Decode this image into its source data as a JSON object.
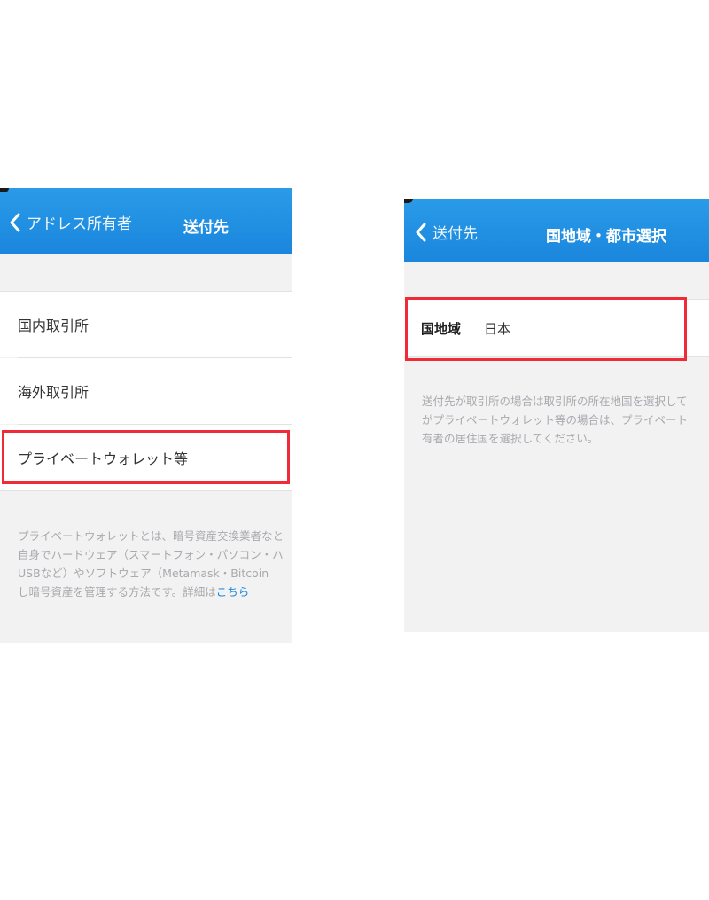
{
  "left": {
    "nav": {
      "back_label": "アドレス所有者",
      "title": "送付先"
    },
    "options": [
      {
        "label": "国内取引所"
      },
      {
        "label": "海外取引所"
      },
      {
        "label": "プライベートウォレット等"
      }
    ],
    "note": {
      "line1": "プライベートウォレットとは、暗号資産交換業者なと",
      "line2": "自身でハードウェア（スマートフォン・パソコン・ハ",
      "line3": "USBなど）やソフトウェア（Metamask・Bitcoin",
      "line4_text": "し暗号資産を管理する方法です。詳細は",
      "line4_link": "こちら"
    }
  },
  "right": {
    "nav": {
      "back_label": "送付先",
      "title": "国地域・都市選択"
    },
    "country": {
      "label": "国地域",
      "value": "日本"
    },
    "note": {
      "line1": "送付先が取引所の場合は取引所の所在地国を選択して",
      "line2": "がプライベートウォレット等の場合は、プライベート",
      "line3": "有者の居住国を選択してください。"
    }
  },
  "colors": {
    "nav_blue": "#1a86dd",
    "highlight_red": "#ee2b36",
    "link_blue": "#1c86dd"
  },
  "icons": {
    "back": "chevron-left-icon"
  }
}
